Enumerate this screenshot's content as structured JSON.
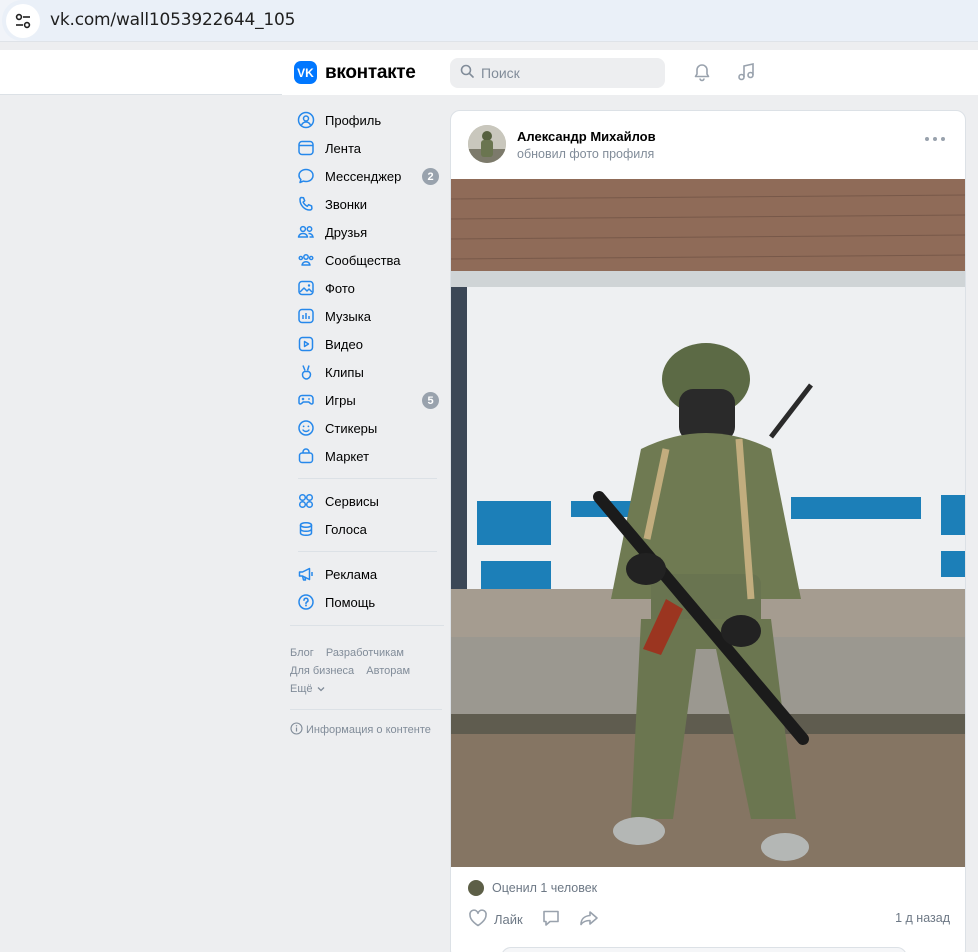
{
  "browser": {
    "url": "vk.com/wall1053922644_105",
    "site_info_icon": "tune-icon"
  },
  "header": {
    "logo_text": "вконтакте",
    "logo_mark": "VK",
    "search_placeholder": "Поиск",
    "icons": [
      "bell-icon",
      "music-icon"
    ],
    "accent": "#0077ff"
  },
  "nav": {
    "primary": [
      {
        "label": "Профиль",
        "icon": "user-circle-icon"
      },
      {
        "label": "Лента",
        "icon": "newsfeed-icon"
      },
      {
        "label": "Мессенджер",
        "icon": "message-icon",
        "badge": "2"
      },
      {
        "label": "Звонки",
        "icon": "phone-icon"
      },
      {
        "label": "Друзья",
        "icon": "friends-icon"
      },
      {
        "label": "Сообщества",
        "icon": "communities-icon"
      },
      {
        "label": "Фото",
        "icon": "photo-icon"
      },
      {
        "label": "Музыка",
        "icon": "music-icon"
      },
      {
        "label": "Видео",
        "icon": "video-icon"
      },
      {
        "label": "Клипы",
        "icon": "clips-icon"
      },
      {
        "label": "Игры",
        "icon": "games-icon",
        "badge": "5"
      },
      {
        "label": "Стикеры",
        "icon": "smile-icon"
      },
      {
        "label": "Маркет",
        "icon": "bag-icon"
      }
    ],
    "secondary": [
      {
        "label": "Сервисы",
        "icon": "services-icon"
      },
      {
        "label": "Голоса",
        "icon": "coins-icon"
      }
    ],
    "tertiary": [
      {
        "label": "Реклама",
        "icon": "megaphone-icon"
      },
      {
        "label": "Помощь",
        "icon": "help-icon"
      }
    ],
    "footer_links": [
      "Блог",
      "Разработчикам",
      "Для бизнеса",
      "Авторам"
    ],
    "more_label": "Ещё",
    "info_content": "Информация о контенте"
  },
  "post": {
    "author": "Александр Михайлов",
    "action_text": "обновил фото профиля",
    "liked_by": "Оценил 1 человек",
    "like_label": "Лайк",
    "time": "1 д назад"
  }
}
